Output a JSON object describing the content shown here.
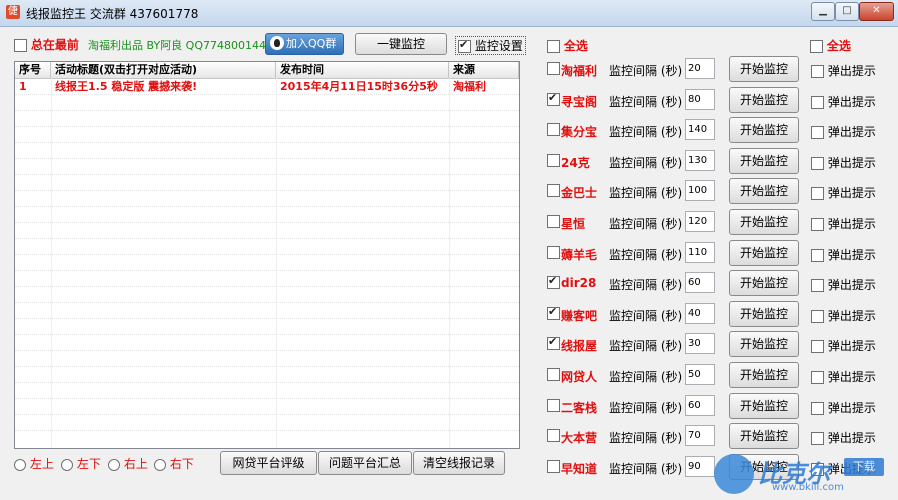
{
  "window": {
    "title": "线报监控王 交流群 437601778",
    "icon_char": "倢",
    "min_btn": "▁",
    "max_btn": "□",
    "close_btn": "✕"
  },
  "toolbar": {
    "always_on_top": {
      "label": "总在最前",
      "checked": false
    },
    "credit": "淘福利出品 BY阿良 QQ774800144",
    "qq_group_btn": "加入QQ群",
    "one_click_btn": "一键监控",
    "settings": {
      "label": "监控设置",
      "checked": true
    }
  },
  "listview": {
    "columns": [
      "序号",
      "活动标题(双击打开对应活动)",
      "发布时间",
      "来源"
    ],
    "rows": [
      {
        "no": "1",
        "title": "线报王1.5  稳定版 震撼来袭!",
        "time": "2015年4月11日15时36分5秒",
        "source": "淘福利"
      }
    ]
  },
  "position_radios": [
    {
      "label": "左上"
    },
    {
      "label": "左下"
    },
    {
      "label": "右上"
    },
    {
      "label": "右下"
    }
  ],
  "bottom_buttons": [
    "网贷平台评级",
    "问题平台汇总",
    "清空线报记录"
  ],
  "select_all_left": {
    "label": "全选",
    "checked": false
  },
  "select_all_right": {
    "label": "全选",
    "checked": false
  },
  "interval_label": "监控间隔 (秒)",
  "start_label": "开始监控",
  "popup_label": "弹出提示",
  "platforms": [
    {
      "name": "淘福利",
      "checked": false,
      "interval": "20",
      "popup": false
    },
    {
      "name": "寻宝阁",
      "checked": true,
      "interval": "80",
      "popup": false
    },
    {
      "name": "集分宝",
      "checked": false,
      "interval": "140",
      "popup": false
    },
    {
      "name": "24克",
      "checked": false,
      "interval": "130",
      "popup": false
    },
    {
      "name": "金巴士",
      "checked": false,
      "interval": "100",
      "popup": false
    },
    {
      "name": "星恒",
      "checked": false,
      "interval": "120",
      "popup": false
    },
    {
      "name": "薅羊毛",
      "checked": false,
      "interval": "110",
      "popup": false
    },
    {
      "name": "dir28",
      "checked": true,
      "interval": "60",
      "popup": false
    },
    {
      "name": "赚客吧",
      "checked": true,
      "interval": "40",
      "popup": false
    },
    {
      "name": "线报屋",
      "checked": true,
      "interval": "30",
      "popup": false
    },
    {
      "name": "网贷人",
      "checked": false,
      "interval": "50",
      "popup": false
    },
    {
      "name": "二客栈",
      "checked": false,
      "interval": "60",
      "popup": false
    },
    {
      "name": "大本营",
      "checked": false,
      "interval": "70",
      "popup": false
    },
    {
      "name": "早知道",
      "checked": false,
      "interval": "90",
      "popup": false
    }
  ],
  "watermark": {
    "brand": "比克尔",
    "download": "下载",
    "url": "www.bkill.com"
  }
}
